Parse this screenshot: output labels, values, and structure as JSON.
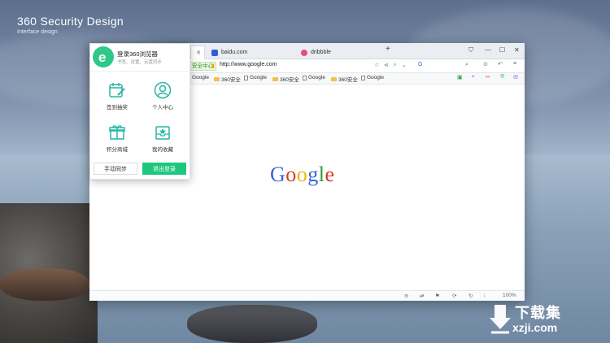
{
  "brand": {
    "title": "360 Security Design",
    "subtitle": "Interface design"
  },
  "tabs": [
    {
      "label": "",
      "active": true
    },
    {
      "label": "baidu.com",
      "active": false,
      "fav_color": "#2f5fd8"
    },
    {
      "label": "dribbble",
      "active": false,
      "fav_color": "#e84a8a"
    }
  ],
  "addressbar": {
    "secure_label": "安全中心",
    "url": "http://www.google.com",
    "extra": "G"
  },
  "bookmarks": [
    {
      "label": "Google",
      "type": "page"
    },
    {
      "label": "360安全",
      "type": "folder"
    },
    {
      "label": "Google",
      "type": "page"
    },
    {
      "label": "360安全",
      "type": "folder"
    },
    {
      "label": "Google",
      "type": "page"
    },
    {
      "label": "360安全",
      "type": "folder"
    },
    {
      "label": "Google",
      "type": "page"
    }
  ],
  "content": {
    "logo_letters": [
      "G",
      "o",
      "o",
      "g",
      "l",
      "e"
    ],
    "logo_colors": [
      "#3b64d8",
      "#d9382c",
      "#f0b400",
      "#3b64d8",
      "#2a9b3c",
      "#d9382c"
    ]
  },
  "status": {
    "zoom": "100%"
  },
  "popup": {
    "title": "登录360浏览器",
    "subtitle": "书签、设置、云盘同步",
    "items": [
      {
        "label": "签到抽奖",
        "icon": "signin-calendar-icon"
      },
      {
        "label": "个人中心",
        "icon": "profile-avatar-icon"
      },
      {
        "label": "积分商城",
        "icon": "gift-box-icon"
      },
      {
        "label": "我的收藏",
        "icon": "favorites-inbox-icon"
      }
    ],
    "sync_label": "手动同步",
    "logout_label": "退出登录"
  },
  "watermark": {
    "text": "下载集",
    "url": "xzji.com"
  }
}
